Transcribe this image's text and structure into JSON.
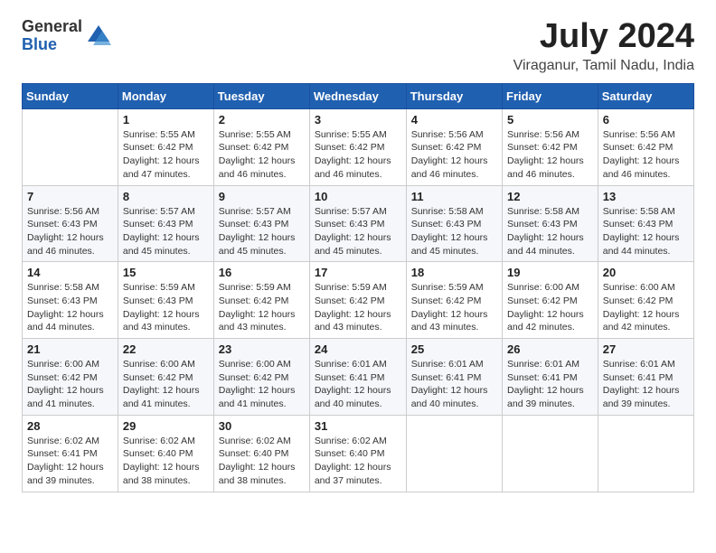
{
  "logo": {
    "general": "General",
    "blue": "Blue"
  },
  "header": {
    "month": "July 2024",
    "location": "Viraganur, Tamil Nadu, India"
  },
  "weekdays": [
    "Sunday",
    "Monday",
    "Tuesday",
    "Wednesday",
    "Thursday",
    "Friday",
    "Saturday"
  ],
  "weeks": [
    [
      {
        "day": "",
        "info": ""
      },
      {
        "day": "1",
        "info": "Sunrise: 5:55 AM\nSunset: 6:42 PM\nDaylight: 12 hours\nand 47 minutes."
      },
      {
        "day": "2",
        "info": "Sunrise: 5:55 AM\nSunset: 6:42 PM\nDaylight: 12 hours\nand 46 minutes."
      },
      {
        "day": "3",
        "info": "Sunrise: 5:55 AM\nSunset: 6:42 PM\nDaylight: 12 hours\nand 46 minutes."
      },
      {
        "day": "4",
        "info": "Sunrise: 5:56 AM\nSunset: 6:42 PM\nDaylight: 12 hours\nand 46 minutes."
      },
      {
        "day": "5",
        "info": "Sunrise: 5:56 AM\nSunset: 6:42 PM\nDaylight: 12 hours\nand 46 minutes."
      },
      {
        "day": "6",
        "info": "Sunrise: 5:56 AM\nSunset: 6:42 PM\nDaylight: 12 hours\nand 46 minutes."
      }
    ],
    [
      {
        "day": "7",
        "info": "Sunrise: 5:56 AM\nSunset: 6:43 PM\nDaylight: 12 hours\nand 46 minutes."
      },
      {
        "day": "8",
        "info": "Sunrise: 5:57 AM\nSunset: 6:43 PM\nDaylight: 12 hours\nand 45 minutes."
      },
      {
        "day": "9",
        "info": "Sunrise: 5:57 AM\nSunset: 6:43 PM\nDaylight: 12 hours\nand 45 minutes."
      },
      {
        "day": "10",
        "info": "Sunrise: 5:57 AM\nSunset: 6:43 PM\nDaylight: 12 hours\nand 45 minutes."
      },
      {
        "day": "11",
        "info": "Sunrise: 5:58 AM\nSunset: 6:43 PM\nDaylight: 12 hours\nand 45 minutes."
      },
      {
        "day": "12",
        "info": "Sunrise: 5:58 AM\nSunset: 6:43 PM\nDaylight: 12 hours\nand 44 minutes."
      },
      {
        "day": "13",
        "info": "Sunrise: 5:58 AM\nSunset: 6:43 PM\nDaylight: 12 hours\nand 44 minutes."
      }
    ],
    [
      {
        "day": "14",
        "info": "Sunrise: 5:58 AM\nSunset: 6:43 PM\nDaylight: 12 hours\nand 44 minutes."
      },
      {
        "day": "15",
        "info": "Sunrise: 5:59 AM\nSunset: 6:43 PM\nDaylight: 12 hours\nand 43 minutes."
      },
      {
        "day": "16",
        "info": "Sunrise: 5:59 AM\nSunset: 6:42 PM\nDaylight: 12 hours\nand 43 minutes."
      },
      {
        "day": "17",
        "info": "Sunrise: 5:59 AM\nSunset: 6:42 PM\nDaylight: 12 hours\nand 43 minutes."
      },
      {
        "day": "18",
        "info": "Sunrise: 5:59 AM\nSunset: 6:42 PM\nDaylight: 12 hours\nand 43 minutes."
      },
      {
        "day": "19",
        "info": "Sunrise: 6:00 AM\nSunset: 6:42 PM\nDaylight: 12 hours\nand 42 minutes."
      },
      {
        "day": "20",
        "info": "Sunrise: 6:00 AM\nSunset: 6:42 PM\nDaylight: 12 hours\nand 42 minutes."
      }
    ],
    [
      {
        "day": "21",
        "info": "Sunrise: 6:00 AM\nSunset: 6:42 PM\nDaylight: 12 hours\nand 41 minutes."
      },
      {
        "day": "22",
        "info": "Sunrise: 6:00 AM\nSunset: 6:42 PM\nDaylight: 12 hours\nand 41 minutes."
      },
      {
        "day": "23",
        "info": "Sunrise: 6:00 AM\nSunset: 6:42 PM\nDaylight: 12 hours\nand 41 minutes."
      },
      {
        "day": "24",
        "info": "Sunrise: 6:01 AM\nSunset: 6:41 PM\nDaylight: 12 hours\nand 40 minutes."
      },
      {
        "day": "25",
        "info": "Sunrise: 6:01 AM\nSunset: 6:41 PM\nDaylight: 12 hours\nand 40 minutes."
      },
      {
        "day": "26",
        "info": "Sunrise: 6:01 AM\nSunset: 6:41 PM\nDaylight: 12 hours\nand 39 minutes."
      },
      {
        "day": "27",
        "info": "Sunrise: 6:01 AM\nSunset: 6:41 PM\nDaylight: 12 hours\nand 39 minutes."
      }
    ],
    [
      {
        "day": "28",
        "info": "Sunrise: 6:02 AM\nSunset: 6:41 PM\nDaylight: 12 hours\nand 39 minutes."
      },
      {
        "day": "29",
        "info": "Sunrise: 6:02 AM\nSunset: 6:40 PM\nDaylight: 12 hours\nand 38 minutes."
      },
      {
        "day": "30",
        "info": "Sunrise: 6:02 AM\nSunset: 6:40 PM\nDaylight: 12 hours\nand 38 minutes."
      },
      {
        "day": "31",
        "info": "Sunrise: 6:02 AM\nSunset: 6:40 PM\nDaylight: 12 hours\nand 37 minutes."
      },
      {
        "day": "",
        "info": ""
      },
      {
        "day": "",
        "info": ""
      },
      {
        "day": "",
        "info": ""
      }
    ]
  ]
}
